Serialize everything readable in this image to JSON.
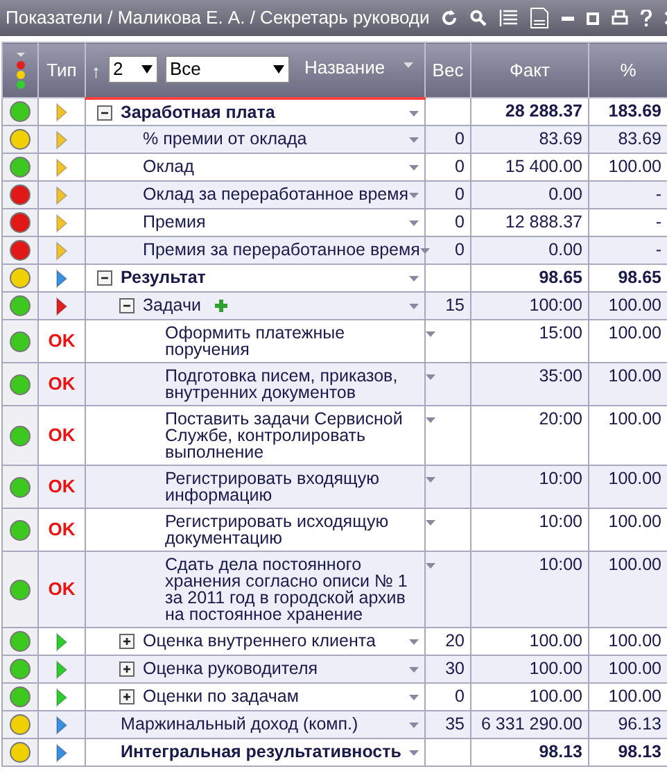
{
  "window": {
    "title": "Показатели / Маликова Е. А. / Секретарь руководи"
  },
  "header": {
    "type_label": "Тип",
    "sort_arrow": "↑",
    "level_select": "2",
    "filter_select": "Все",
    "name_label": "Название",
    "weight_label": "Вес",
    "fact_label": "Факт",
    "percent_label": "%"
  },
  "rows": [
    {
      "color": "#3cc81e",
      "kind": "salary",
      "name": "Заработная плата",
      "bold": true,
      "expanded": true,
      "fact": "28 288.37",
      "percent": "183.69",
      "children": [
        {
          "color": "#f0d000",
          "kind": "salary",
          "name": "% премии от оклада",
          "weight": "0",
          "fact": "83.69",
          "percent": "83.69"
        },
        {
          "color": "#3cc81e",
          "kind": "salary",
          "name": "Оклад",
          "weight": "0",
          "fact": "15 400.00",
          "percent": "100.00"
        },
        {
          "color": "#e01818",
          "kind": "salary",
          "name": "Оклад за переработанное время",
          "weight": "0",
          "fact": "0.00",
          "percent": "-"
        },
        {
          "color": "#e01818",
          "kind": "salary",
          "name": "Премия",
          "weight": "0",
          "fact": "12 888.37",
          "percent": "-"
        },
        {
          "color": "#e01818",
          "kind": "salary",
          "name": "Премия за переработанное время",
          "weight": "0",
          "fact": "0.00",
          "percent": "-"
        }
      ]
    },
    {
      "color": "#f0d000",
      "kind": "result",
      "name": "Результат",
      "bold": true,
      "expanded": true,
      "fact": "98.65",
      "percent": "98.65",
      "children": [
        {
          "color": "#3cc81e",
          "kind": "tasks",
          "name": "Задачи",
          "expanded": true,
          "added": true,
          "weight": "15",
          "fact": "100:00",
          "percent": "100.00",
          "children": [
            {
              "color": "#3cc81e",
              "kind": "task",
              "type_text": "OK",
              "name": "Оформить платежные поручения",
              "fact": "15:00",
              "percent": "100.00"
            },
            {
              "color": "#3cc81e",
              "kind": "task",
              "type_text": "OK",
              "name": "Подготовка писем, приказов, внутренних документов",
              "fact": "35:00",
              "percent": "100.00"
            },
            {
              "color": "#3cc81e",
              "kind": "task",
              "type_text": "OK",
              "name": "Поставить задачи Сервисной Службе, контролировать выполнение",
              "fact": "20:00",
              "percent": "100.00"
            },
            {
              "color": "#3cc81e",
              "kind": "task",
              "type_text": "OK",
              "name": "Регистрировать входящую информацию",
              "fact": "10:00",
              "percent": "100.00"
            },
            {
              "color": "#3cc81e",
              "kind": "task",
              "type_text": "OK",
              "name": "Регистрировать исходящую документацию",
              "fact": "10:00",
              "percent": "100.00"
            },
            {
              "color": "#3cc81e",
              "kind": "task",
              "type_text": "OK",
              "name": "Сдать дела постоянного хранения согласно описи № 1 за 2011 год в городской архив на постоянное хранение",
              "fact": "10:00",
              "percent": "100.00"
            }
          ]
        },
        {
          "color": "#3cc81e",
          "kind": "rating",
          "name": "Оценка внутреннего клиента",
          "expanded": false,
          "weight": "20",
          "fact": "100.00",
          "percent": "100.00"
        },
        {
          "color": "#3cc81e",
          "kind": "rating",
          "name": "Оценка руководителя",
          "expanded": false,
          "weight": "30",
          "fact": "100.00",
          "percent": "100.00"
        },
        {
          "color": "#3cc81e",
          "kind": "rating",
          "name": "Оценки по задачам",
          "expanded": false,
          "weight": "0",
          "fact": "100.00",
          "percent": "100.00"
        }
      ]
    },
    {
      "color": "#f0d000",
      "kind": "result",
      "name": "Маржинальный доход (комп.)",
      "weight": "35",
      "fact": "6 331 290.00",
      "percent": "96.13"
    },
    {
      "color": "#f0d000",
      "kind": "result",
      "name": "Интегральная результативность",
      "bold": true,
      "fact": "98.13",
      "percent": "98.13"
    }
  ]
}
